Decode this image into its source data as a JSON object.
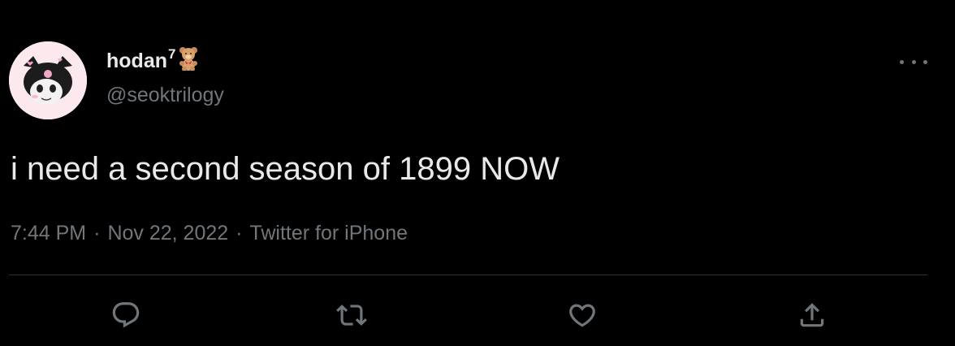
{
  "tweet": {
    "display_name": "hodan",
    "name_superscript": "7",
    "name_emoji": "teddy-bear-icon",
    "handle": "@seoktrilogy",
    "text": "i need a second season of 1899 NOW",
    "time": "7:44 PM",
    "date": "Nov 22, 2022",
    "source": "Twitter for iPhone",
    "separator": "·"
  },
  "actions": [
    {
      "name": "reply",
      "icon": "reply-icon"
    },
    {
      "name": "retweet",
      "icon": "retweet-icon"
    },
    {
      "name": "like",
      "icon": "heart-icon"
    },
    {
      "name": "share",
      "icon": "share-icon"
    }
  ],
  "colors": {
    "background": "#000000",
    "primary_text": "#e7e9ea",
    "secondary_text": "#71767b",
    "divider": "#2f3336"
  }
}
